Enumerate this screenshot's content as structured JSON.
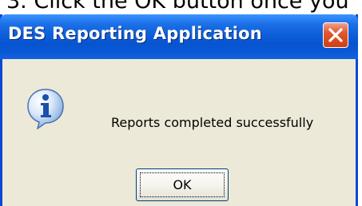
{
  "background_text": "3.  Click the OK button once you",
  "dialog": {
    "title": "DES Reporting Application",
    "message": "Reports completed successfully",
    "ok_label": "OK",
    "icon": "info-icon",
    "close_icon": "close-icon"
  },
  "colors": {
    "titlebar": "#0a59d6",
    "dialog_body": "#ece9d8",
    "close_button": "#e2572f",
    "button_border": "#003c74"
  }
}
